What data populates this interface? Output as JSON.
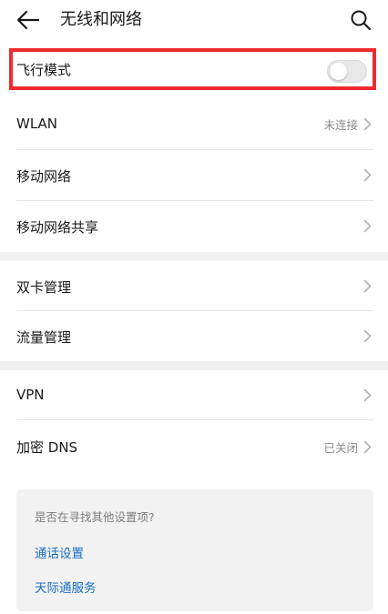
{
  "header": {
    "title": "无线和网络",
    "back_icon": "back-arrow-icon",
    "search_icon": "search-icon"
  },
  "airplane": {
    "label": "飞行模式",
    "enabled": false,
    "highlight_color": "#ee2b2f"
  },
  "group1": [
    {
      "label": "WLAN",
      "value": "未连接"
    },
    {
      "label": "移动网络",
      "value": ""
    },
    {
      "label": "移动网络共享",
      "value": ""
    }
  ],
  "group2": [
    {
      "label": "双卡管理",
      "value": ""
    },
    {
      "label": "流量管理",
      "value": ""
    }
  ],
  "group3": [
    {
      "label": "VPN",
      "value": ""
    },
    {
      "label": "加密 DNS",
      "value": "已关闭"
    }
  ],
  "suggestions": {
    "hint": "是否在寻找其他设置项?",
    "links": [
      "通话设置",
      "天际通服务"
    ],
    "link_color": "#1a6fc4"
  }
}
